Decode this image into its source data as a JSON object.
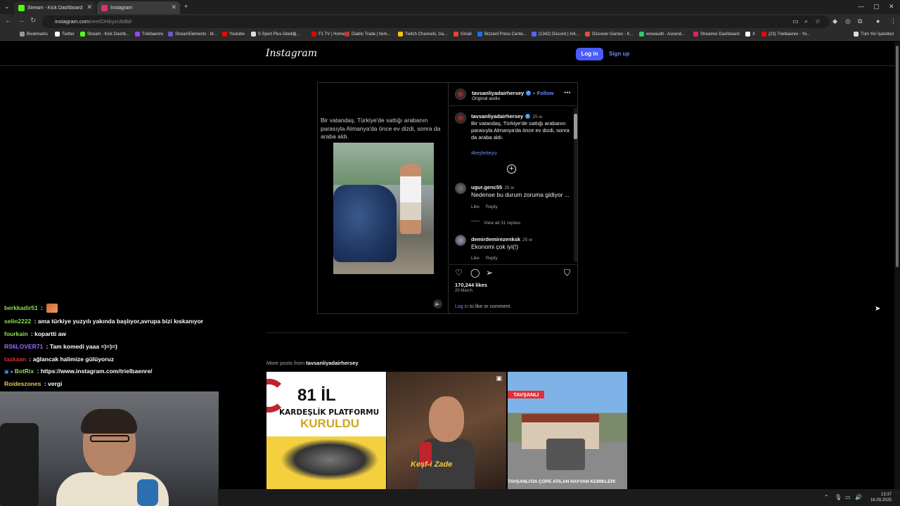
{
  "browser": {
    "tabs": [
      {
        "label": "Stream - Kick Dashboard",
        "favicon_color": "#53fc18"
      },
      {
        "label": "Instagram",
        "favicon_color": "#e1306c"
      }
    ],
    "url_host": "instagram.com",
    "url_path": "/reel/DHbyzUbtlbl/",
    "bookmarks": [
      {
        "label": "Bookmarks",
        "color": "#999"
      },
      {
        "label": "Twitter",
        "color": "#fff"
      },
      {
        "label": "Stream - Kick Dashb...",
        "color": "#53fc18"
      },
      {
        "label": "Trielbaenre",
        "color": "#9146ff"
      },
      {
        "label": "StreamElements - M...",
        "color": "#6a5acd"
      },
      {
        "label": "Youtube",
        "color": "#ff0000"
      },
      {
        "label": "S Sport Plus-İstediği...",
        "color": "#ddd"
      },
      {
        "label": "F1 TV | Home",
        "color": "#e10600"
      },
      {
        "label": "Diablo Trade | Item...",
        "color": "#c0392b"
      },
      {
        "label": "Twitch Channels, Ga...",
        "color": "#f1c40f"
      },
      {
        "label": "Gmail",
        "color": "#ea4335"
      },
      {
        "label": "Bizzard Press Cente...",
        "color": "#1a73e8"
      },
      {
        "label": "(1342) Discord | Ark...",
        "color": "#5865f2"
      },
      {
        "label": "Discover Games - K...",
        "color": "#e74c3c"
      },
      {
        "label": "wowaudit - Ascend...",
        "color": "#2ecc71"
      },
      {
        "label": "Streamer Dashboard",
        "color": "#e91e63"
      },
      {
        "label": "X",
        "color": "#fff"
      },
      {
        "label": "(23) Trielbaenre - Yo...",
        "color": "#ff0000"
      },
      {
        "label": "Tüm Yer İşaretleri",
        "color": "#ddd"
      }
    ]
  },
  "instagram": {
    "logo": "Instagram",
    "login_label": "Log in",
    "signup_label": "Sign up",
    "post": {
      "media_caption": "Bir vatandaş, Türkiye'de sattığı arabanın parasıyla Almanya'da önce ev dizdi, sonra da araba aldı.",
      "author": "tavsanliyadairhersey",
      "follow_label": "Follow",
      "separator": "•",
      "audio_label": "Original audio",
      "caption_time": "25 w",
      "caption_text": "Bir vatandaş, Türkiye'de sattığı arabanın parasıyla Almanya'da önce ev dizdi, sonra da araba aldı.",
      "hashtag": "#keşfetteyiz",
      "comments": [
        {
          "user": "ugur.genc55",
          "time": "25 w",
          "text": "Nedense bu durum zoruma gidiyor ...",
          "like": "Like",
          "reply": "Reply",
          "view_replies": "View all 31 replies"
        },
        {
          "user": "demirdemirezenksk",
          "time": "25 w",
          "text": "Ekonomi çok iyi(!)",
          "like": "Like",
          "reply": "Reply"
        }
      ],
      "likes": "170,244 likes",
      "date": "20 March",
      "login_link": "Log in",
      "login_suffix": " to like or comment."
    },
    "more_posts_prefix": "More posts from",
    "more_posts_author": "tavsanliyadairhersey",
    "thumbs": {
      "t1_81": "81 İL",
      "t1_line1": "KARDEŞLİK PLATFORMU",
      "t1_line2": "KURULDU",
      "t2_caption": "Keşf-i Zade",
      "t3_tag": "TAVŞANLI",
      "t3_caption": "TAVŞANLI'DA ÇÖPE ATILAN HAYVAN KEMİKLERİ"
    }
  },
  "chat": [
    {
      "user": "berkkadir51",
      "color": "#8ae34a",
      "message": "",
      "emote": true
    },
    {
      "user": "selin2222",
      "color": "#8ae34a",
      "message": "ama türkiye yuzyılı yakında başlıyor,avrupa bizi kıskanıyor"
    },
    {
      "user": "fourkain",
      "color": "#8ae34a",
      "message": "kopartti aw"
    },
    {
      "user": "RS6LOVER71",
      "color": "#9b6bff",
      "message": "Tam komedi yaaa =)=)=)"
    },
    {
      "user": "tazkaan",
      "color": "#e0302f",
      "message": "ağlancak halimize gülüyoruz"
    },
    {
      "user": "BotRix",
      "color": "#8ae34a",
      "message": "https://www.instagram.com/trielbaenre/",
      "badge": true
    },
    {
      "user": "Roideszones",
      "color": "#e8c94a",
      "message": "vergi"
    }
  ],
  "taskbar": {
    "time": "13:37",
    "date": "16.09.2025"
  }
}
